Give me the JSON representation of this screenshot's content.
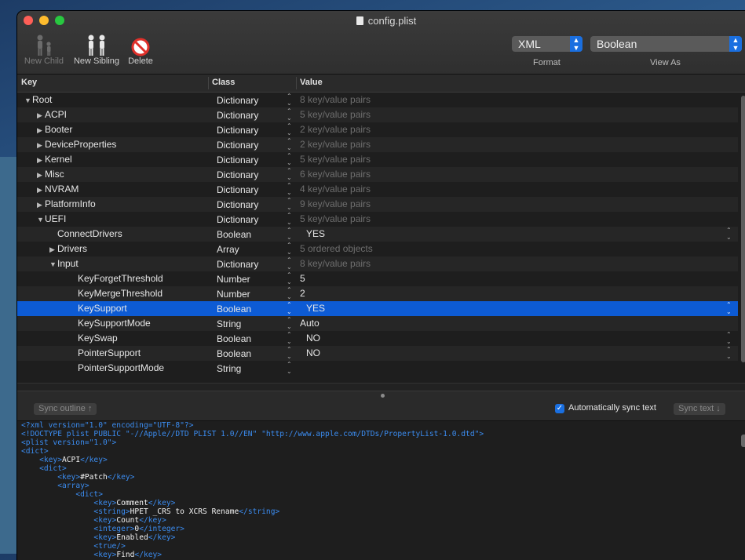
{
  "window": {
    "title": "config.plist"
  },
  "toolbar": {
    "new_child": "New Child",
    "new_sibling": "New Sibling",
    "delete": "Delete",
    "format_value": "XML",
    "format_label": "Format",
    "view_as_value": "Boolean",
    "view_as_label": "View As"
  },
  "columns": {
    "key": "Key",
    "class": "Class",
    "value": "Value"
  },
  "rows": [
    {
      "key": "Root",
      "class": "Dictionary",
      "value": "8 key/value pairs",
      "level": 0,
      "expander": "open"
    },
    {
      "key": "ACPI",
      "class": "Dictionary",
      "value": "5 key/value pairs",
      "level": 1,
      "expander": "closed"
    },
    {
      "key": "Booter",
      "class": "Dictionary",
      "value": "2 key/value pairs",
      "level": 1,
      "expander": "closed"
    },
    {
      "key": "DeviceProperties",
      "class": "Dictionary",
      "value": "2 key/value pairs",
      "level": 1,
      "expander": "closed"
    },
    {
      "key": "Kernel",
      "class": "Dictionary",
      "value": "5 key/value pairs",
      "level": 1,
      "expander": "closed"
    },
    {
      "key": "Misc",
      "class": "Dictionary",
      "value": "6 key/value pairs",
      "level": 1,
      "expander": "closed"
    },
    {
      "key": "NVRAM",
      "class": "Dictionary",
      "value": "4 key/value pairs",
      "level": 1,
      "expander": "closed"
    },
    {
      "key": "PlatformInfo",
      "class": "Dictionary",
      "value": "9 key/value pairs",
      "level": 1,
      "expander": "closed"
    },
    {
      "key": "UEFI",
      "class": "Dictionary",
      "value": "5 key/value pairs",
      "level": 1,
      "expander": "open"
    },
    {
      "key": "ConnectDrivers",
      "class": "Boolean",
      "value": "YES",
      "level": 2,
      "expander": "none"
    },
    {
      "key": "Drivers",
      "class": "Array",
      "value": "5 ordered objects",
      "level": 2,
      "expander": "closed"
    },
    {
      "key": "Input",
      "class": "Dictionary",
      "value": "8 key/value pairs",
      "level": 2,
      "expander": "open"
    },
    {
      "key": "KeyForgetThreshold",
      "class": "Number",
      "value": "5",
      "level": 3,
      "expander": "none"
    },
    {
      "key": "KeyMergeThreshold",
      "class": "Number",
      "value": "2",
      "level": 3,
      "expander": "none"
    },
    {
      "key": "KeySupport",
      "class": "Boolean",
      "value": "YES",
      "level": 3,
      "expander": "none",
      "selected": true
    },
    {
      "key": "KeySupportMode",
      "class": "String",
      "value": "Auto",
      "level": 3,
      "expander": "none"
    },
    {
      "key": "KeySwap",
      "class": "Boolean",
      "value": "NO",
      "level": 3,
      "expander": "none"
    },
    {
      "key": "PointerSupport",
      "class": "Boolean",
      "value": "NO",
      "level": 3,
      "expander": "none"
    },
    {
      "key": "PointerSupportMode",
      "class": "String",
      "value": "",
      "level": 3,
      "expander": "none"
    }
  ],
  "sync": {
    "outline_button": "Sync outline ↑",
    "auto_label": "Automatically sync text",
    "auto_checked": true,
    "text_button": "Sync text ↓"
  },
  "xml_lines": [
    "<?xml version=\"1.0\" encoding=\"UTF-8\"?>",
    "<!DOCTYPE plist PUBLIC \"-//Apple//DTD PLIST 1.0//EN\" \"http://www.apple.com/DTDs/PropertyList-1.0.dtd\">",
    "<plist version=\"1.0\">",
    "<dict>",
    "    <key>ACPI</key>",
    "    <dict>",
    "        <key>#Patch</key>",
    "        <array>",
    "            <dict>",
    "                <key>Comment</key>",
    "                <string>HPET _CRS to XCRS Rename</string>",
    "                <key>Count</key>",
    "                <integer>0</integer>",
    "                <key>Enabled</key>",
    "                <true/>",
    "                <key>Find</key>"
  ]
}
